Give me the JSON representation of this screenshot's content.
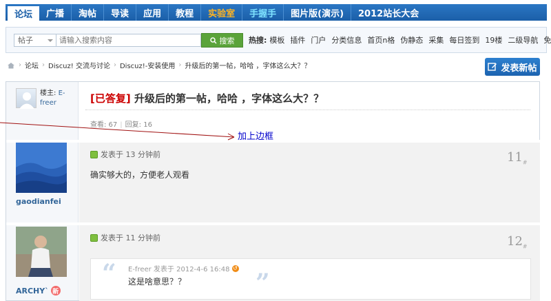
{
  "topnav": {
    "items": [
      "论坛",
      "广播",
      "淘帖",
      "导读",
      "应用",
      "教程",
      "实验室",
      "手握手",
      "图片版(演示)",
      "2012站长大会"
    ],
    "colors": {
      "lab": "#ffb422",
      "hands": "#7fe3ff"
    }
  },
  "search": {
    "scope": "帖子",
    "placeholder": "请输入搜索内容",
    "button_label": "搜索",
    "hot_label": "热搜:",
    "hot_links": [
      "模板",
      "插件",
      "门户",
      "分类信息",
      "首页n格",
      "伪静态",
      "采集",
      "每日签到",
      "19楼",
      "二级导航",
      "免费模板"
    ]
  },
  "breadcrumb": {
    "items": [
      "论坛",
      "Discuz! 交流与讨论",
      "Discuz!-安装使用",
      "升级后的第一帖，哈哈 ，字体这么大？？"
    ]
  },
  "new_post_label": "发表新帖",
  "thread": {
    "op_label": "楼主:",
    "op_author": "E-freer",
    "tag": "[已答复]",
    "title": "升级后的第一帖，哈哈 ，字体这么大？？",
    "views": "查看: 67",
    "replies": "回复: 16"
  },
  "annotation": "加上边框",
  "posts": [
    {
      "username": "gaodianfei",
      "meta": "发表于 13 分钟前",
      "floor": "11",
      "body": "确实够大的，方便老人观看"
    },
    {
      "username": "ARCHY`",
      "badge": "新",
      "meta": "发表于 11 分钟前",
      "floor": "12",
      "quote_author": "E-freer 发表于 2012-4-6 16:48",
      "quote_text": "这是啥意思？？"
    }
  ],
  "floor_suffix": "#"
}
